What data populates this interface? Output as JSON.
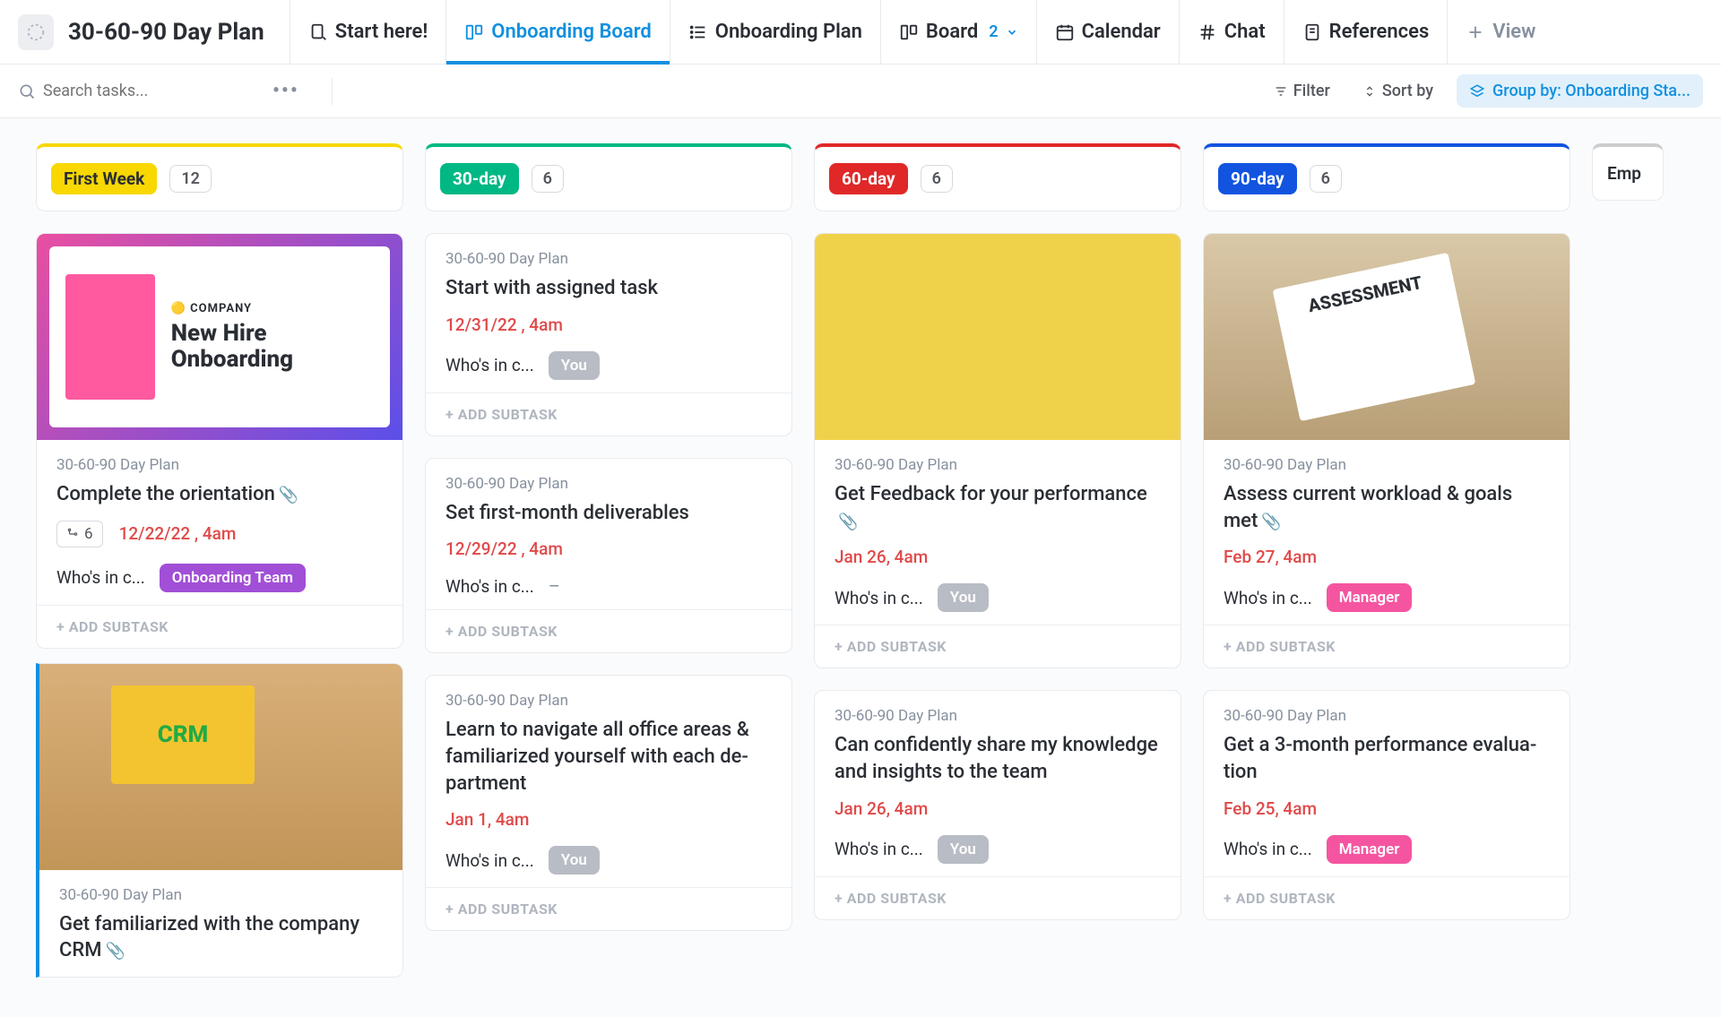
{
  "workspace": {
    "title": "30-60-90 Day Plan"
  },
  "nav": {
    "start": "Start here!",
    "onboarding_board": "Onboarding Board",
    "onboarding_plan": "Onboarding Plan",
    "board": "Board",
    "board_badge": "2",
    "calendar": "Calendar",
    "chat": "Chat",
    "references": "References",
    "view": "View"
  },
  "toolbar": {
    "search_placeholder": "Search tasks...",
    "filter": "Filter",
    "sort": "Sort by",
    "groupby": "Group by: Onboarding Sta..."
  },
  "columns": [
    {
      "stage": "First Week",
      "count": "12",
      "color": "yellow"
    },
    {
      "stage": "30-day",
      "count": "6",
      "color": "green"
    },
    {
      "stage": "60-day",
      "count": "6",
      "color": "red"
    },
    {
      "stage": "90-day",
      "count": "6",
      "color": "blue"
    }
  ],
  "extra_col": "Emp",
  "list_name": "30-60-90 Day Plan",
  "who_label": "Who's in c...",
  "add_subtask": "+ ADD SUBTASK",
  "assignees": {
    "onboarding_team": "Onboarding Team",
    "you": "You",
    "manager": "Manager"
  },
  "cover": {
    "company": "🟡 COMPANY",
    "headline": "New Hire Onboarding",
    "crm": "CRM",
    "assess": "ASSESSMENT"
  },
  "cards": {
    "c0": {
      "title": "Complete the orientation",
      "due": "12/22/22 , 4am",
      "sub": "6"
    },
    "c1": {
      "title": "Get familiarized with the company CRM"
    },
    "c2": {
      "title": "Start with assigned task",
      "due": "12/31/22 , 4am"
    },
    "c3": {
      "title": "Set first-month deliverables",
      "due": "12/29/22 , 4am"
    },
    "c4": {
      "title": "Learn to navigate all office areas & familiarized yourself with each de­partment",
      "due": "Jan 1, 4am"
    },
    "c5": {
      "title": "Get Feedback for your performance",
      "due": "Jan 26, 4am"
    },
    "c6": {
      "title": "Can confidently share my knowl­edge and insights to the team",
      "due": "Jan 26, 4am"
    },
    "c7": {
      "title": "Assess current workload & goals met",
      "due": "Feb 27, 4am"
    },
    "c8": {
      "title": "Get a 3-month performance evalua­tion",
      "due": "Feb 25, 4am"
    }
  }
}
